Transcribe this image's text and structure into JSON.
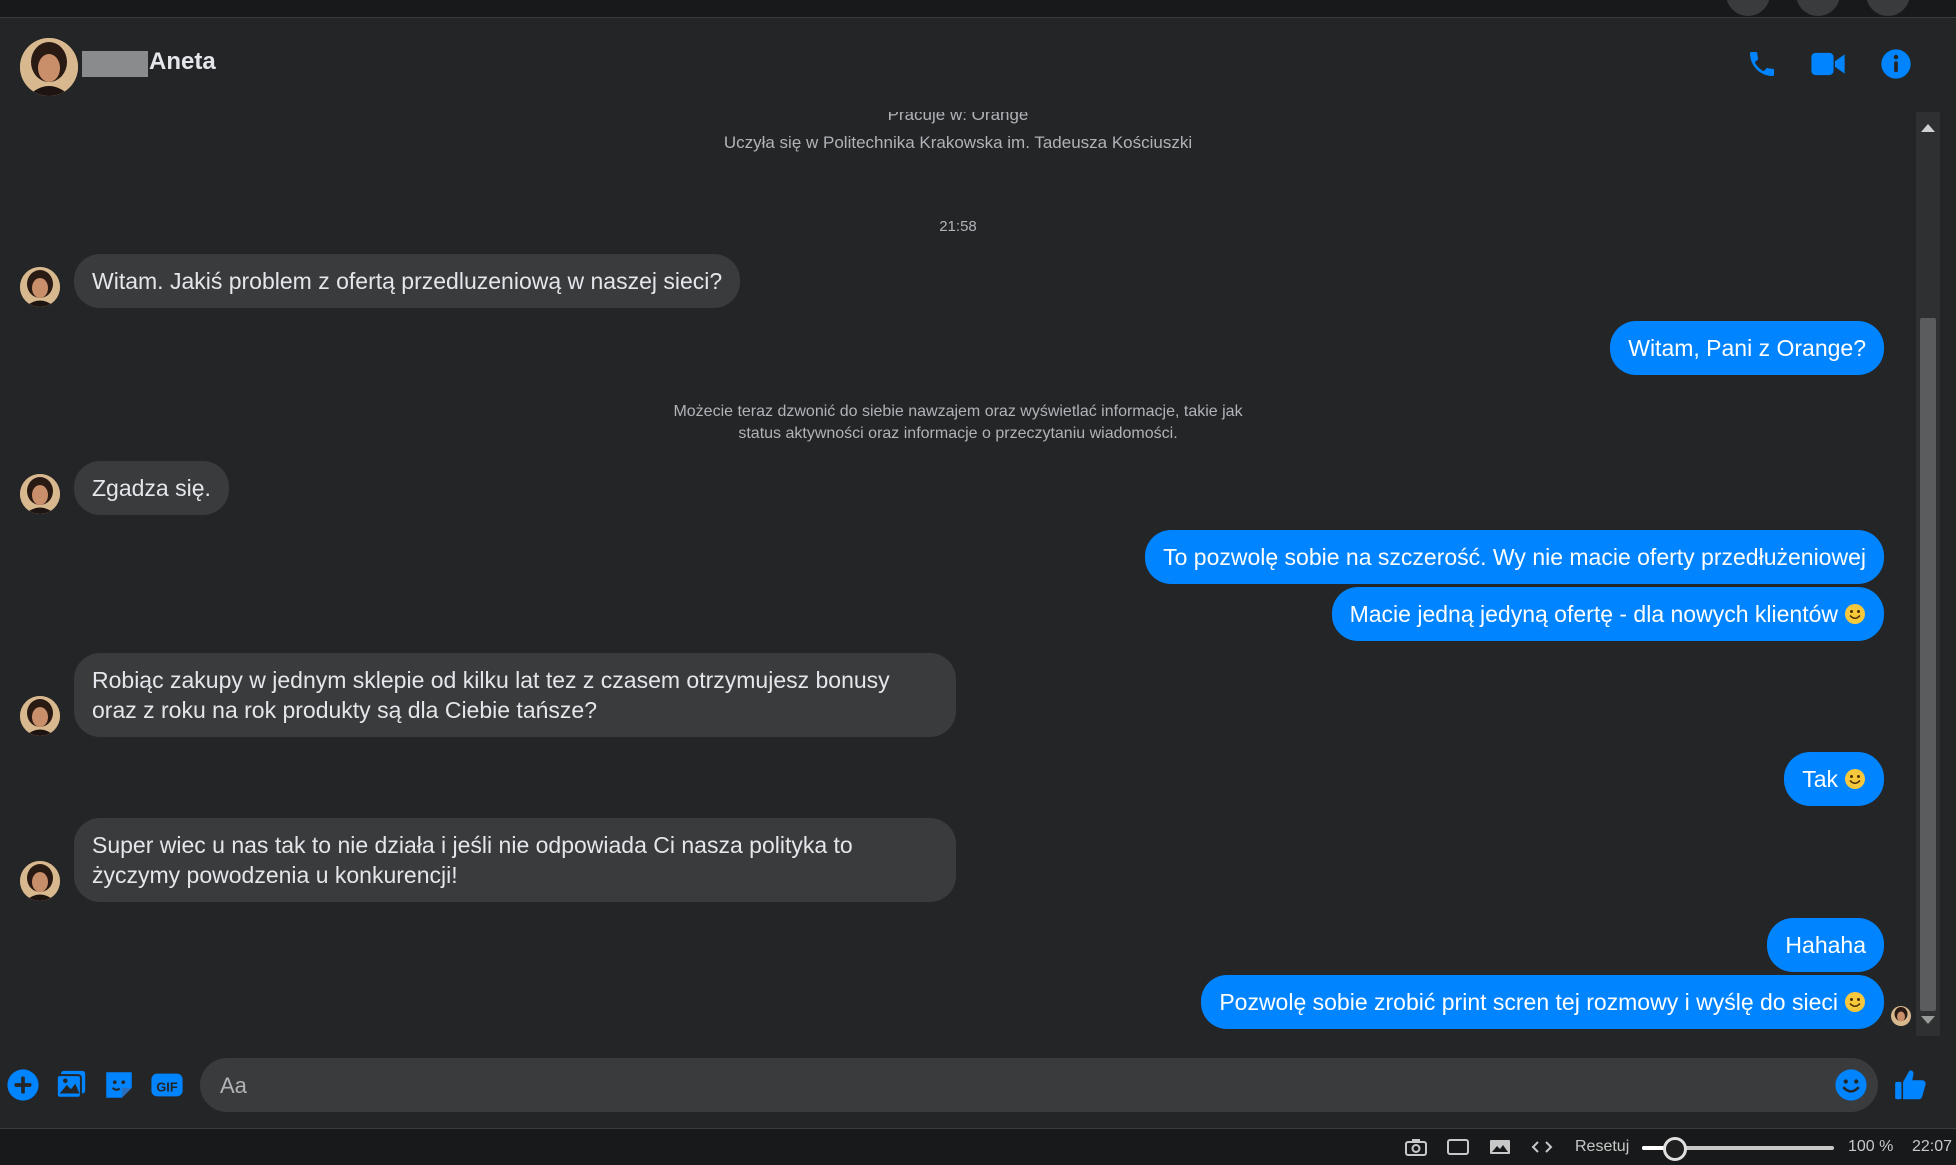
{
  "header": {
    "contact_name": "Aneta",
    "icons": [
      "phone-icon",
      "video-camera-icon",
      "info-icon"
    ],
    "accent": "#0084ff"
  },
  "intro": {
    "work": "Pracuje w: Orange",
    "study": "Uczyła się w Politechnika Krakowska im. Tadeusza Kościuszki"
  },
  "timestamp": "21:58",
  "system_notice": {
    "line1": "Możecie teraz dzwonić do siebie nawzajem oraz wyświetlać informacje, takie jak",
    "line2": "status aktywności oraz informacje o przeczytaniu wiadomości."
  },
  "messages": [
    {
      "direction": "in",
      "text": "Witam. Jakiś problem z ofertą przedluzeniową w naszej sieci?"
    },
    {
      "direction": "out",
      "text": "Witam, Pani z Orange?"
    },
    {
      "direction": "in",
      "text": "Zgadza się."
    },
    {
      "direction": "out",
      "text": "To pozwolę sobie na szczerość. Wy nie macie oferty przedłużeniowej"
    },
    {
      "direction": "out",
      "text": "Macie jedną jedyną ofertę - dla nowych klientów",
      "emoji": "smile"
    },
    {
      "direction": "in",
      "text": "Robiąc zakupy w jednym sklepie od kilku lat tez z czasem otrzymujesz bonusy oraz z roku na rok produkty są dla Ciebie tańsze?"
    },
    {
      "direction": "out",
      "text": "Tak",
      "emoji": "smile"
    },
    {
      "direction": "in",
      "text": "Super wiec u nas tak to nie działa i jeśli nie odpowiada Ci nasza polityka to życzymy powodzenia u konkurencji!"
    },
    {
      "direction": "out",
      "text": "Hahaha"
    },
    {
      "direction": "out",
      "text": "Pozwolę sobie zrobić print scren tej rozmowy i wyślę do sieci",
      "emoji": "smile"
    }
  ],
  "composer": {
    "placeholder": "Aa",
    "icons": [
      "plus-icon",
      "photo-icon",
      "sticker-icon",
      "gif-icon",
      "emoji-icon",
      "thumbs-up-icon"
    ],
    "gif_label": "GIF"
  },
  "statusbar": {
    "reset_label": "Resetuj",
    "zoom": "100 %",
    "zoom_level": 0.17,
    "clock": "22:07",
    "icons": [
      "screenshot-camera-icon",
      "window-icon",
      "image-icon",
      "code-icon"
    ]
  }
}
